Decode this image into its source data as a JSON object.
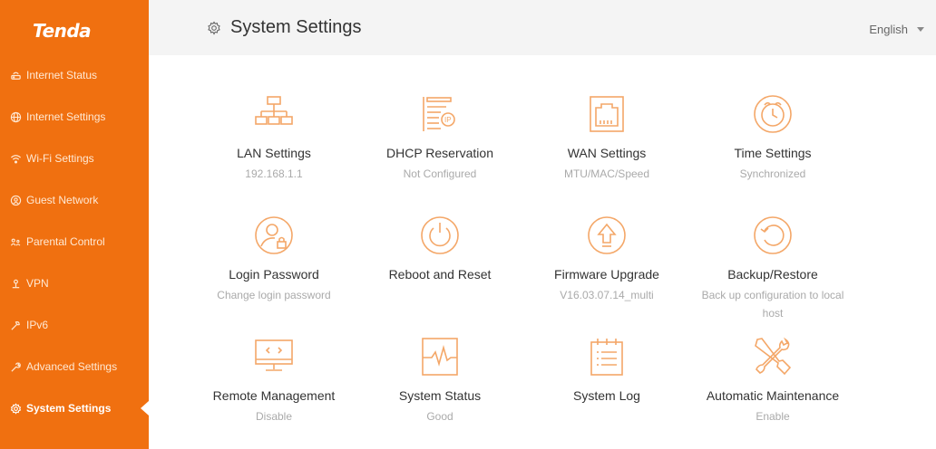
{
  "brand": {
    "logo_text": "Tenda",
    "accent": "#f07010"
  },
  "sidebar": {
    "items": [
      {
        "label": "Internet Status",
        "icon": "router-icon"
      },
      {
        "label": "Internet Settings",
        "icon": "globe-icon"
      },
      {
        "label": "Wi-Fi Settings",
        "icon": "wifi-icon"
      },
      {
        "label": "Guest Network",
        "icon": "guest-icon"
      },
      {
        "label": "Parental Control",
        "icon": "parental-icon"
      },
      {
        "label": "VPN",
        "icon": "vpn-icon"
      },
      {
        "label": "IPv6",
        "icon": "ipv6-icon"
      },
      {
        "label": "Advanced Settings",
        "icon": "wrench-icon"
      },
      {
        "label": "System Settings",
        "icon": "gear-icon",
        "active": true
      }
    ]
  },
  "header": {
    "title": "System Settings",
    "language": "English"
  },
  "cards": [
    {
      "label": "LAN Settings",
      "sub": "192.168.1.1",
      "icon": "network-tree-icon"
    },
    {
      "label": "DHCP Reservation",
      "sub": "Not Configured",
      "icon": "ip-list-icon"
    },
    {
      "label": "WAN Settings",
      "sub": "MTU/MAC/Speed",
      "icon": "ethernet-port-icon"
    },
    {
      "label": "Time Settings",
      "sub": "Synchronized",
      "icon": "alarm-clock-icon"
    },
    {
      "label": "Login Password",
      "sub": "Change login password",
      "icon": "user-lock-icon"
    },
    {
      "label": "Reboot and Reset",
      "sub": "",
      "icon": "power-icon"
    },
    {
      "label": "Firmware Upgrade",
      "sub": "V16.03.07.14_multi",
      "icon": "upgrade-arrow-icon"
    },
    {
      "label": "Backup/Restore",
      "sub": "Back up configuration to local host",
      "icon": "backup-restore-icon"
    },
    {
      "label": "Remote Management",
      "sub": "Disable",
      "icon": "remote-monitor-icon"
    },
    {
      "label": "System Status",
      "sub": "Good",
      "icon": "pulse-monitor-icon"
    },
    {
      "label": "System Log",
      "sub": "",
      "icon": "log-clipboard-icon"
    },
    {
      "label": "Automatic Maintenance",
      "sub": "Enable",
      "icon": "tools-icon"
    }
  ]
}
